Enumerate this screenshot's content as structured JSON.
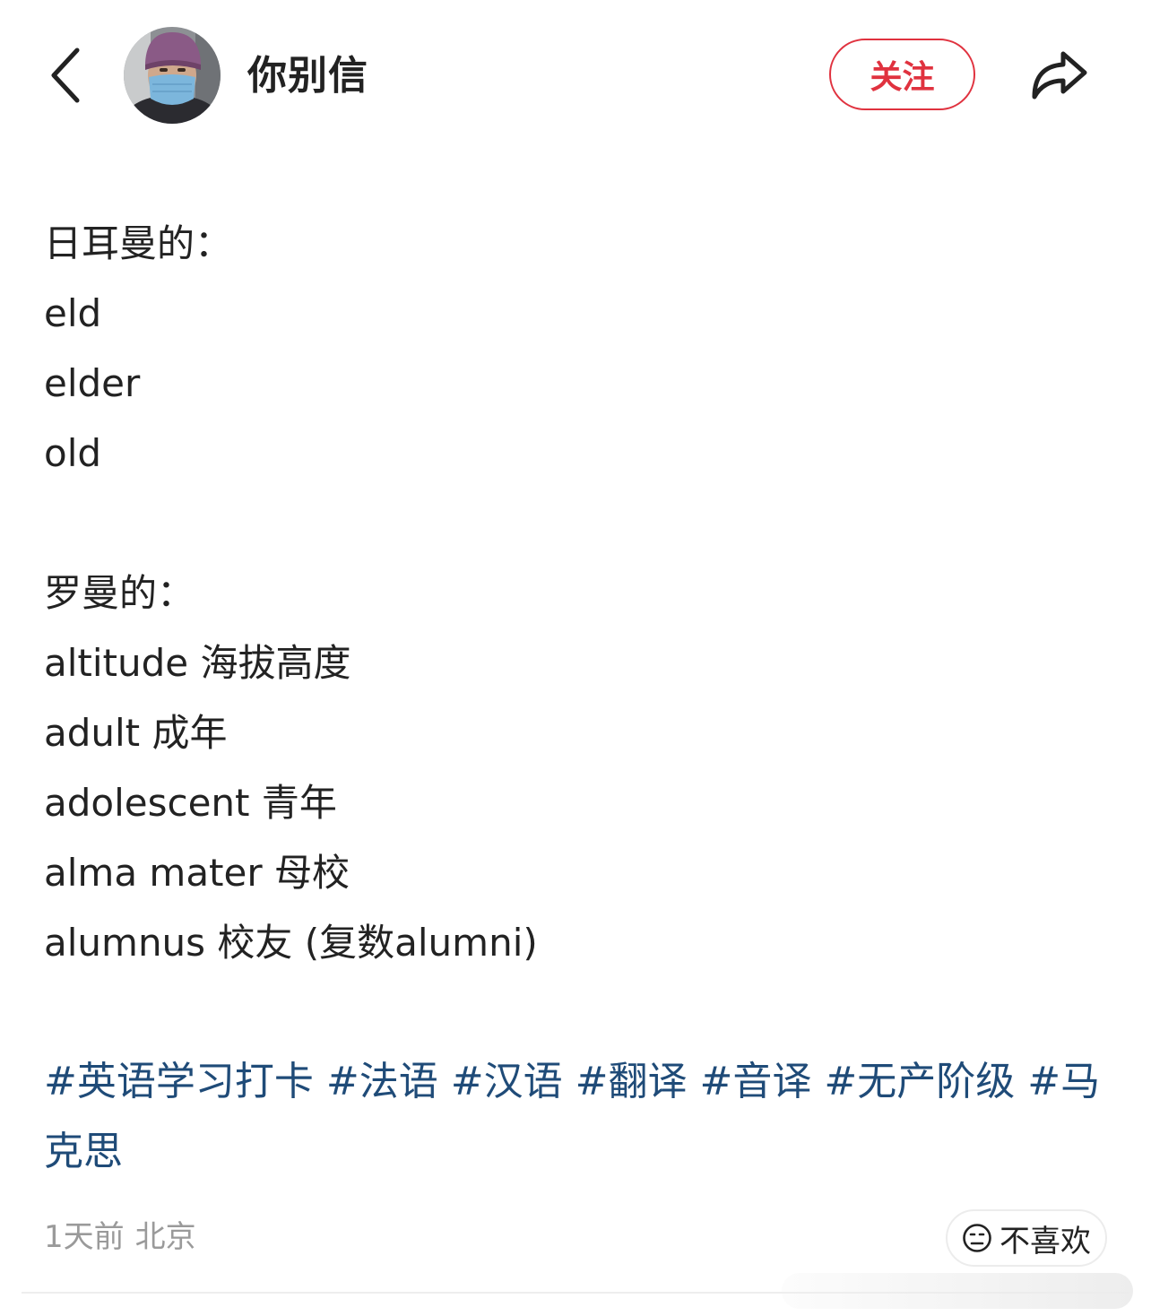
{
  "header": {
    "author_name": "你别信",
    "follow_label": "关注"
  },
  "post": {
    "lines": [
      "日耳曼的：",
      "eld",
      "elder",
      "old",
      "",
      "罗曼的：",
      "altitude 海拔高度",
      "adult 成年",
      "adolescent 青年",
      "alma mater 母校",
      "alumnus 校友 (复数alumni)"
    ],
    "hashtags": [
      "#英语学习打卡",
      "#法语",
      "#汉语",
      "#翻译",
      "#音译",
      "#无产阶级",
      "#马克思"
    ]
  },
  "footer": {
    "time": "1天前",
    "location": "北京",
    "dislike_label": "不喜欢"
  },
  "colors": {
    "accent_red": "#e0323f",
    "hashtag_blue": "#1f4b78",
    "meta_gray": "#9a9a9a"
  },
  "icons": {
    "back": "chevron-left-icon",
    "share": "share-arrow-icon",
    "dislike": "frown-face-icon"
  }
}
